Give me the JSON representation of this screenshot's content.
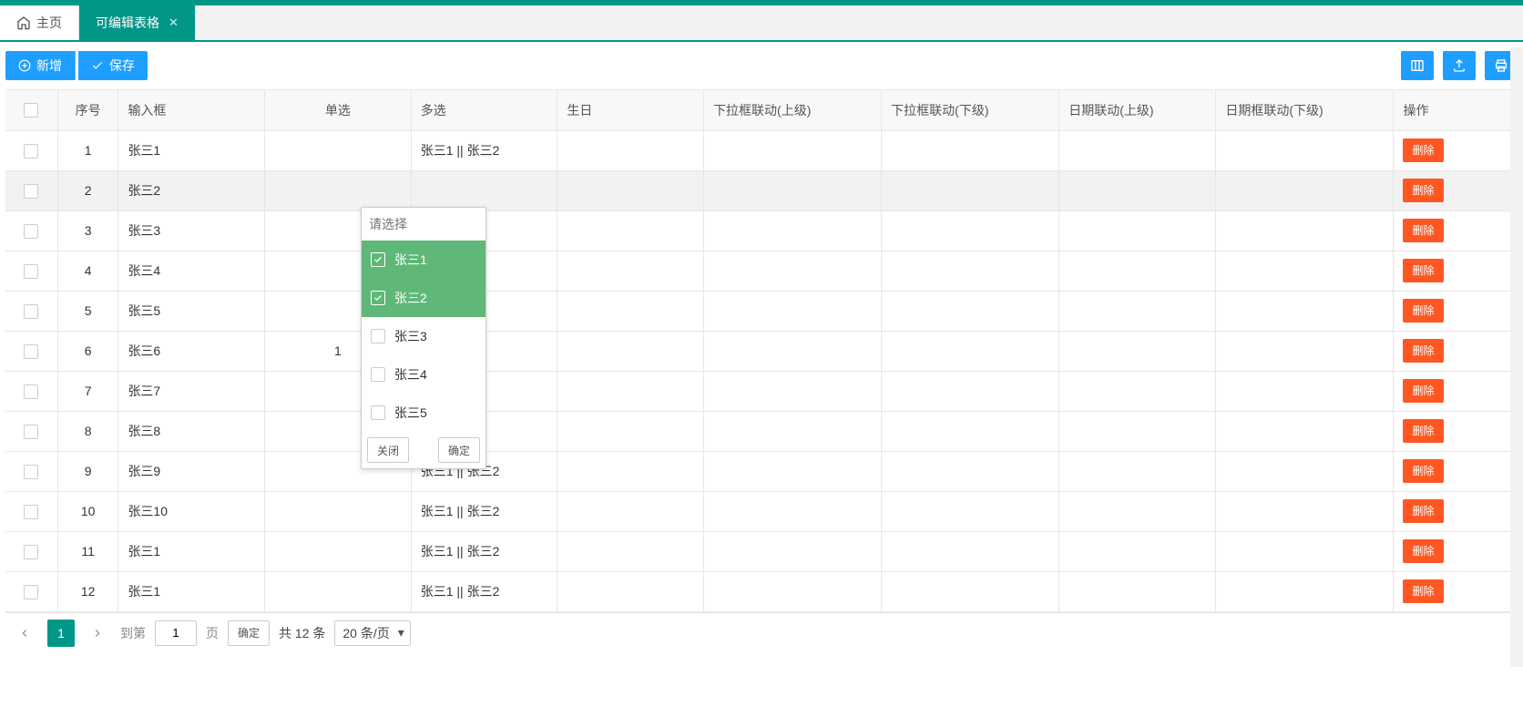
{
  "colors": {
    "primary": "#009688",
    "blue": "#1E9FFF",
    "orange": "#FF5722",
    "green": "#5FB878"
  },
  "tabs": {
    "home_label": "主页",
    "editable_label": "可编辑表格"
  },
  "toolbar": {
    "add_label": "新增",
    "save_label": "保存",
    "icon_cols": "columns-icon",
    "icon_export": "export-icon",
    "icon_print": "print-icon"
  },
  "columns": {
    "seq": "序号",
    "input": "输入框",
    "radio": "单选",
    "multi": "多选",
    "birthday": "生日",
    "link_up": "下拉框联动(上级)",
    "link_down": "下拉框联动(下级)",
    "date_up": "日期联动(上级)",
    "date_down": "日期框联动(下级)",
    "ops": "操作"
  },
  "rows": [
    {
      "idx": 1,
      "input": "张三1",
      "radio": "",
      "multi": "张三1 || 张三2"
    },
    {
      "idx": 2,
      "input": "张三2",
      "radio": "",
      "multi": ""
    },
    {
      "idx": 3,
      "input": "张三3",
      "radio": "",
      "multi": ""
    },
    {
      "idx": 4,
      "input": "张三4",
      "radio": "",
      "multi": ""
    },
    {
      "idx": 5,
      "input": "张三5",
      "radio": "",
      "multi": ""
    },
    {
      "idx": 6,
      "input": "张三6",
      "radio": "1",
      "multi": ""
    },
    {
      "idx": 7,
      "input": "张三7",
      "radio": "",
      "multi": ""
    },
    {
      "idx": 8,
      "input": "张三8",
      "radio": "",
      "multi": ""
    },
    {
      "idx": 9,
      "input": "张三9",
      "radio": "",
      "multi": "张三1 || 张三2"
    },
    {
      "idx": 10,
      "input": "张三10",
      "radio": "",
      "multi": "张三1 || 张三2"
    },
    {
      "idx": 11,
      "input": "张三1",
      "radio": "",
      "multi": "张三1 || 张三2"
    },
    {
      "idx": 12,
      "input": "张三1",
      "radio": "",
      "multi": "张三1 || 张三2"
    }
  ],
  "row_delete_label": "删除",
  "popup": {
    "placeholder": "请选择",
    "options": [
      {
        "label": "张三1",
        "selected": true
      },
      {
        "label": "张三2",
        "selected": true
      },
      {
        "label": "张三3",
        "selected": false
      },
      {
        "label": "张三4",
        "selected": false
      },
      {
        "label": "张三5",
        "selected": false
      }
    ],
    "close_label": "关闭",
    "ok_label": "确定"
  },
  "pager": {
    "goto_label": "到第",
    "page_value": "1",
    "page_unit": "页",
    "confirm_label": "确定",
    "total_text": "共 12 条",
    "size_label": "20 条/页",
    "current_page": "1"
  }
}
